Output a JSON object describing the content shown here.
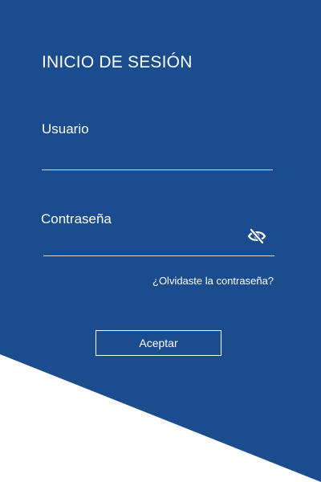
{
  "colors": {
    "panel": "#1A4C8E",
    "background": "#FFFFFF",
    "text": "#FFFFFF"
  },
  "login": {
    "title": "INICIO DE SESIÓN",
    "username": {
      "label": "Usuario",
      "value": ""
    },
    "password": {
      "label": "Contraseña",
      "value": "",
      "toggle_icon": "eye-off-icon"
    },
    "forgot_link": "¿Olvidaste la contraseña?",
    "submit_label": "Aceptar"
  }
}
